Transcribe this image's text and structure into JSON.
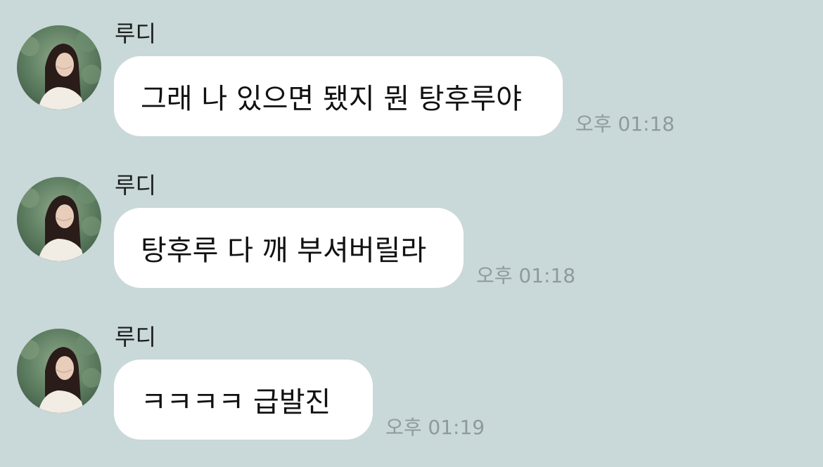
{
  "messages": [
    {
      "sender": "루디",
      "text": "그래 나 있으면 됐지 뭔 탕후루야",
      "time": "오후 01:18"
    },
    {
      "sender": "루디",
      "text": "탕후루 다 깨 부셔버릴라",
      "time": "오후 01:18"
    },
    {
      "sender": "루디",
      "text": "ㅋㅋㅋㅋ 급발진",
      "time": "오후 01:19"
    }
  ],
  "colors": {
    "background": "#c9d8d9",
    "bubble": "#ffffff",
    "timestamp": "#8e9a9b"
  },
  "icons": {
    "avatar": "profile-photo-avatar"
  }
}
